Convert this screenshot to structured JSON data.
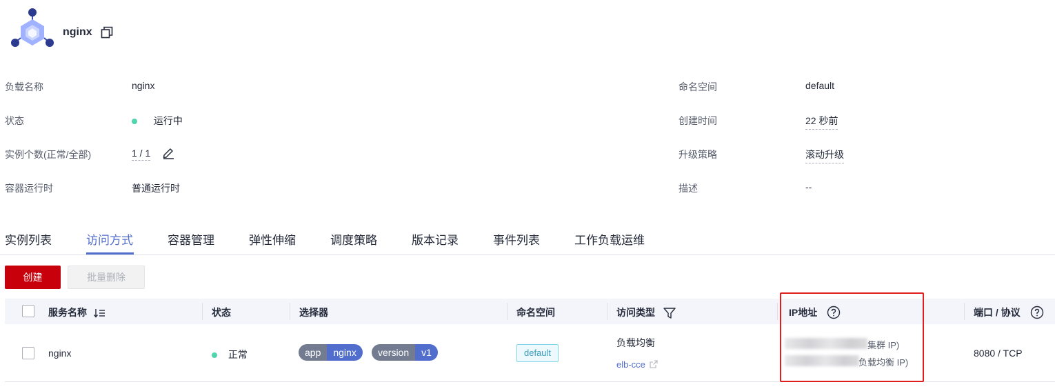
{
  "workload": {
    "name": "nginx",
    "icon": "workload-hexagon-icon"
  },
  "info": {
    "load_name_label": "负载名称",
    "load_name_value": "nginx",
    "status_label": "状态",
    "status_value": "运行中",
    "instances_label": "实例个数(正常/全部)",
    "instances_value": "1 / 1",
    "runtime_label": "容器运行时",
    "runtime_value": "普通运行时",
    "namespace_label": "命名空间",
    "namespace_value": "default",
    "created_label": "创建时间",
    "created_value": "22 秒前",
    "upgrade_label": "升级策略",
    "upgrade_value": "滚动升级",
    "desc_label": "描述",
    "desc_value": "--"
  },
  "tabs": [
    {
      "label": "实例列表"
    },
    {
      "label": "访问方式",
      "active": true
    },
    {
      "label": "容器管理"
    },
    {
      "label": "弹性伸缩"
    },
    {
      "label": "调度策略"
    },
    {
      "label": "版本记录"
    },
    {
      "label": "事件列表"
    },
    {
      "label": "工作负载运维"
    }
  ],
  "toolbar": {
    "create_label": "创建",
    "batch_delete_label": "批量删除"
  },
  "table": {
    "headers": {
      "service_name": "服务名称",
      "status": "状态",
      "selector": "选择器",
      "namespace": "命名空间",
      "access_type": "访问类型",
      "ip": "IP地址",
      "port": "端口 / 协议"
    },
    "rows": [
      {
        "service_name": "nginx",
        "status": "正常",
        "selector": [
          {
            "key": "app",
            "value": "nginx"
          },
          {
            "key": "version",
            "value": "v1"
          }
        ],
        "namespace": "default",
        "access_type": "负载均衡",
        "access_link": "elb-cce",
        "ip_cluster_suffix": "集群 IP)",
        "ip_elb_suffix": "负载均衡 IP)",
        "port": "8080 / TCP"
      }
    ]
  },
  "colors": {
    "primary": "#526ecc",
    "danger": "#c7000b",
    "status_ok": "#50d4ab",
    "highlight": "#e01e1e"
  }
}
